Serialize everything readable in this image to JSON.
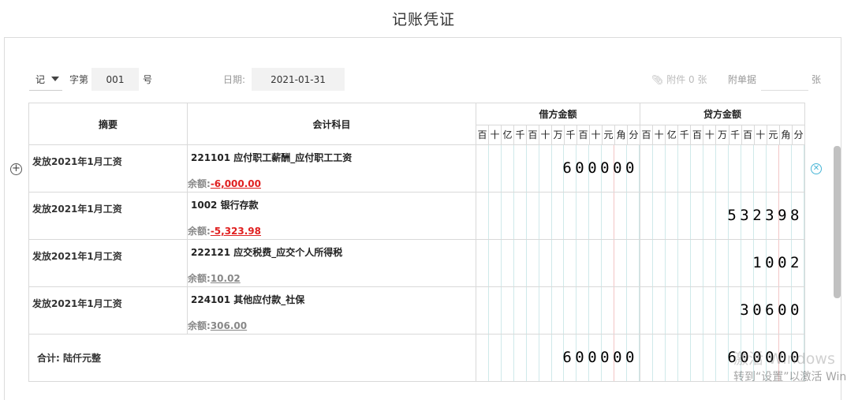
{
  "title": "记账凭证",
  "header": {
    "voucher_type": "记",
    "zi_label": "字第",
    "number": "001",
    "hao_label": "号",
    "date_label": "日期:",
    "date_value": "2021-01-31",
    "attachment_label": "附件 0 张",
    "attach_doc_label": "附单据",
    "zhang_label": "张"
  },
  "table": {
    "col_summary": "摘要",
    "col_subject": "会计科目",
    "col_debit": "借方金额",
    "col_credit": "贷方金额",
    "digit_units": [
      "百",
      "十",
      "亿",
      "千",
      "百",
      "十",
      "万",
      "千",
      "百",
      "十",
      "元",
      "角",
      "分"
    ],
    "balance_label": "余额:",
    "rows": [
      {
        "summary": "发放2021年1月工资",
        "subject": "221101 应付职工薪酬_应付职工工资",
        "balance": "-6,000.00",
        "negative": true,
        "debit": "600000",
        "credit": ""
      },
      {
        "summary": "发放2021年1月工资",
        "subject": "1002 银行存款",
        "balance": "-5,323.98",
        "negative": true,
        "debit": "",
        "credit": "532398"
      },
      {
        "summary": "发放2021年1月工资",
        "subject": "222121 应交税费_应交个人所得税",
        "balance": "10.02",
        "negative": false,
        "debit": "",
        "credit": "1002"
      },
      {
        "summary": "发放2021年1月工资",
        "subject": "224101 其他应付款_社保",
        "balance": "306.00",
        "negative": false,
        "debit": "",
        "credit": "30600"
      }
    ],
    "total_label": "合计:  陆仟元整",
    "total_debit": "600000",
    "total_credit": "600000"
  },
  "watermark": {
    "line1": "激活 Windows",
    "line2": "转到“设置”以激活 Win"
  }
}
